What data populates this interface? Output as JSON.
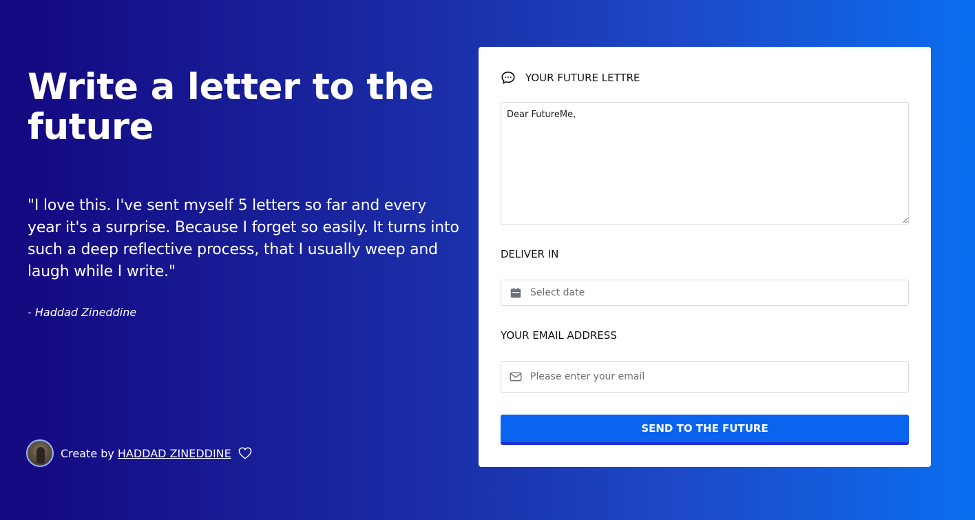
{
  "hero": {
    "title": "Write a letter to the future",
    "quote": "\"I love this. I've sent myself 5 letters so far and every year it's a surprise. Because I forget so easily. It turns into such a deep reflective process, that I usually weep and laugh while I write.\"",
    "author": "- Haddad Zineddine"
  },
  "credit": {
    "prefix": "Create by",
    "name": "HADDAD ZINEDDINE",
    "icons": [
      "avatar",
      "heart-icon"
    ]
  },
  "form": {
    "header": "YOUR FUTURE LETTRE",
    "header_icon": "chat-bubble-icon",
    "letter_value": "Dear FutureMe,",
    "deliver_label": "DELIVER IN",
    "date_placeholder": "Select date",
    "date_icon": "calendar-icon",
    "email_label": "YOUR EMAIL ADDRESS",
    "email_placeholder": "Please enter your email",
    "email_icon": "envelope-icon",
    "submit_label": "SEND TO THE FUTURE"
  },
  "colors": {
    "background_start": "#14077f",
    "background_end": "#0a6ef0",
    "button": "#0a64f0",
    "button_border": "#1f2fd6",
    "card": "#ffffff"
  }
}
